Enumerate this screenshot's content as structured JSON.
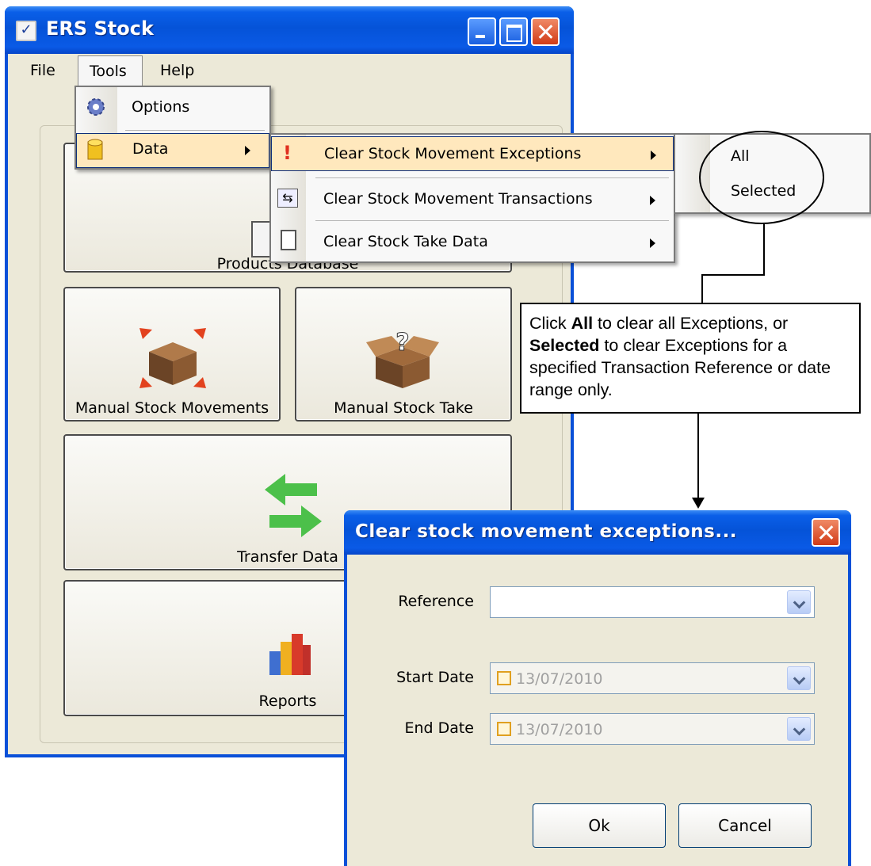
{
  "app": {
    "title": "ERS Stock",
    "title_icon": "clipboard-check-icon"
  },
  "menubar": {
    "file": "File",
    "tools": "Tools",
    "help": "Help"
  },
  "tools_menu": {
    "items": [
      {
        "label": "Options",
        "icon": "gear-icon"
      },
      {
        "label": "Data",
        "icon": "database-icon"
      }
    ]
  },
  "data_menu": {
    "items": [
      {
        "label": "Clear Stock Movement Exceptions",
        "icon": "exclamation-icon"
      },
      {
        "label": "Clear Stock Movement Transactions",
        "icon": "transfer-icon"
      },
      {
        "label": "Clear Stock Take Data",
        "icon": "clipboard-icon"
      }
    ]
  },
  "sub_menu": {
    "items": [
      {
        "label": "All"
      },
      {
        "label": "Selected"
      }
    ]
  },
  "main_buttons": {
    "products": "Products Database",
    "manual_movements": "Manual Stock Movements",
    "manual_take": "Manual Stock Take",
    "transfer": "Transfer Data",
    "reports": "Reports"
  },
  "callout": {
    "p1": "Click ",
    "b1": "All",
    "p2": " to clear all Exceptions, or ",
    "b2": "Selected",
    "p3": " to clear Exceptions for a specified Transaction Reference or date range only."
  },
  "dialog": {
    "title": "Clear stock movement exceptions...",
    "reference_label": "Reference",
    "reference_value": "",
    "start_label": "Start Date",
    "start_value": "13/07/2010",
    "end_label": "End Date",
    "end_value": "13/07/2010",
    "ok": "Ok",
    "cancel": "Cancel"
  }
}
